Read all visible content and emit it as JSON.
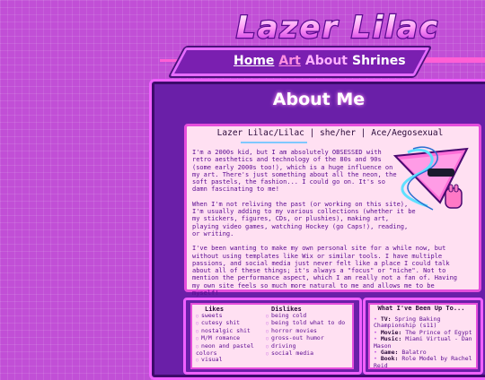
{
  "site": {
    "logo_text": "Lazer Lilac",
    "nav": {
      "home": "Home",
      "art": "Art",
      "about": "About",
      "shrines": "Shrines"
    }
  },
  "page": {
    "title": "About Me",
    "about_header": "Lazer Lilac/Lilac | she/her | Ace/Aegosexual",
    "paragraphs": [
      "I'm a 2000s kid, but I am absolutely OBSESSED with retro aesthetics and technology of the 80s and 90s (some early 2000s too!), which is a huge influence on my art. There's just something about all the neon, the soft pastels, the fashion... I could go on. It's so damn fascinating to me!",
      "When I'm not reliving the past (or working on this site), I'm usually adding to my various collections (whether it be my stickers, figures, CDs, or plushies), making art, playing video games, watching Hockey (go Caps!), reading, or writing.",
      "I've been wanting to make my own personal site for a while now, but without using templates like Wix or similar tools. I have multiple passions, and social media just never felt like a place I could talk about all of these things; it's always a \"focus\" or \"niche\". Not to mention the performance aspect, which I am really not a fan of. Having my own site feels so much more natural to me and allows me to be myself!"
    ],
    "likes": {
      "heading": "Likes",
      "items": [
        "sweets",
        "cutesy shit",
        "nostalgic shit",
        "M/M romance",
        "neon and pastel colors",
        "visual"
      ]
    },
    "dislikes": {
      "heading": "Dislikes",
      "items": [
        "being cold",
        "being told what to do",
        "horror movies",
        "gross-out humor",
        "driving",
        "social media"
      ]
    },
    "doing": {
      "heading": "What I've Been Up To...",
      "items": [
        {
          "label": "TV:",
          "value": "Spring Baking Championship (s11)"
        },
        {
          "label": "Movie:",
          "value": "The Prince of Egypt"
        },
        {
          "label": "Music:",
          "value": "Miami Virtual - Dan Mason"
        },
        {
          "label": "Game:",
          "value": "Balatro"
        },
        {
          "label": "Book:",
          "value": "Role Model by Rachel Reid"
        }
      ]
    }
  },
  "colors": {
    "background": "#c14fd6",
    "panel": "#6a1fa8",
    "border": "#f060ff",
    "card": "#ffe0f2",
    "text": "#5a0a90"
  }
}
